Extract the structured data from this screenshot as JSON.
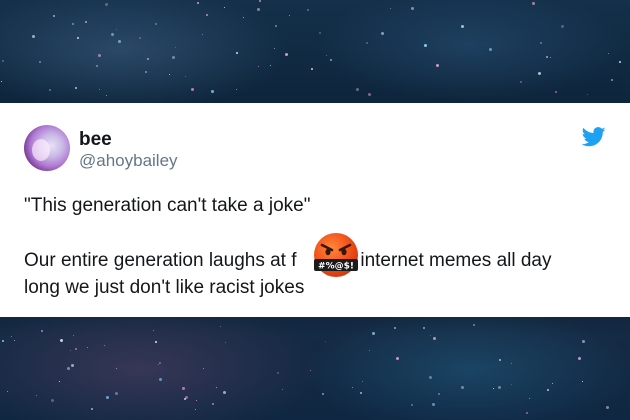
{
  "tweet": {
    "display_name": "bee",
    "handle": "@ahoybailey",
    "line1": "\"This generation can't take a joke\"",
    "line2_before": "Our entire generation laughs at f",
    "line2_after": "g internet memes all day",
    "line3": "long we just don't like racist jokes",
    "censor_text": "#%@$!"
  },
  "icons": {
    "brand": "twitter-bird-icon",
    "emoji": "face-with-symbols-on-mouth-icon"
  },
  "colors": {
    "card_bg": "#ffffff",
    "text": "#14171a",
    "secondary_text": "#657786",
    "twitter_blue": "#1da1f2",
    "emoji_face": "#f2541b"
  }
}
